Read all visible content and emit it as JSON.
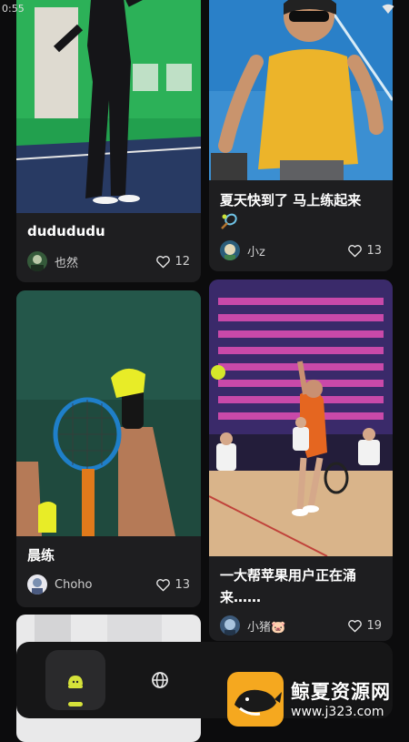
{
  "status": {
    "time": "0:55"
  },
  "posts": [
    {
      "title": "dudududu",
      "author": "也然",
      "likes": "12"
    },
    {
      "title": "夏天快到了 马上练起来",
      "author": "小z",
      "likes": "13"
    },
    {
      "title": "晨练",
      "author": "Choho",
      "likes": "13"
    },
    {
      "title": "一大帮苹果用户正在涌来……",
      "author": "小猪🐷",
      "likes": "19"
    }
  ],
  "icons": {
    "home": "home-icon",
    "discover": "globe-icon",
    "like": "heart-icon",
    "wifi": "wifi-icon"
  },
  "colors": {
    "background": "#0c0c0d",
    "card": "#1e1e20",
    "active_nav": "#d6e23a"
  },
  "watermark": {
    "name": "鲸夏资源网",
    "url": "www.j323.com"
  }
}
